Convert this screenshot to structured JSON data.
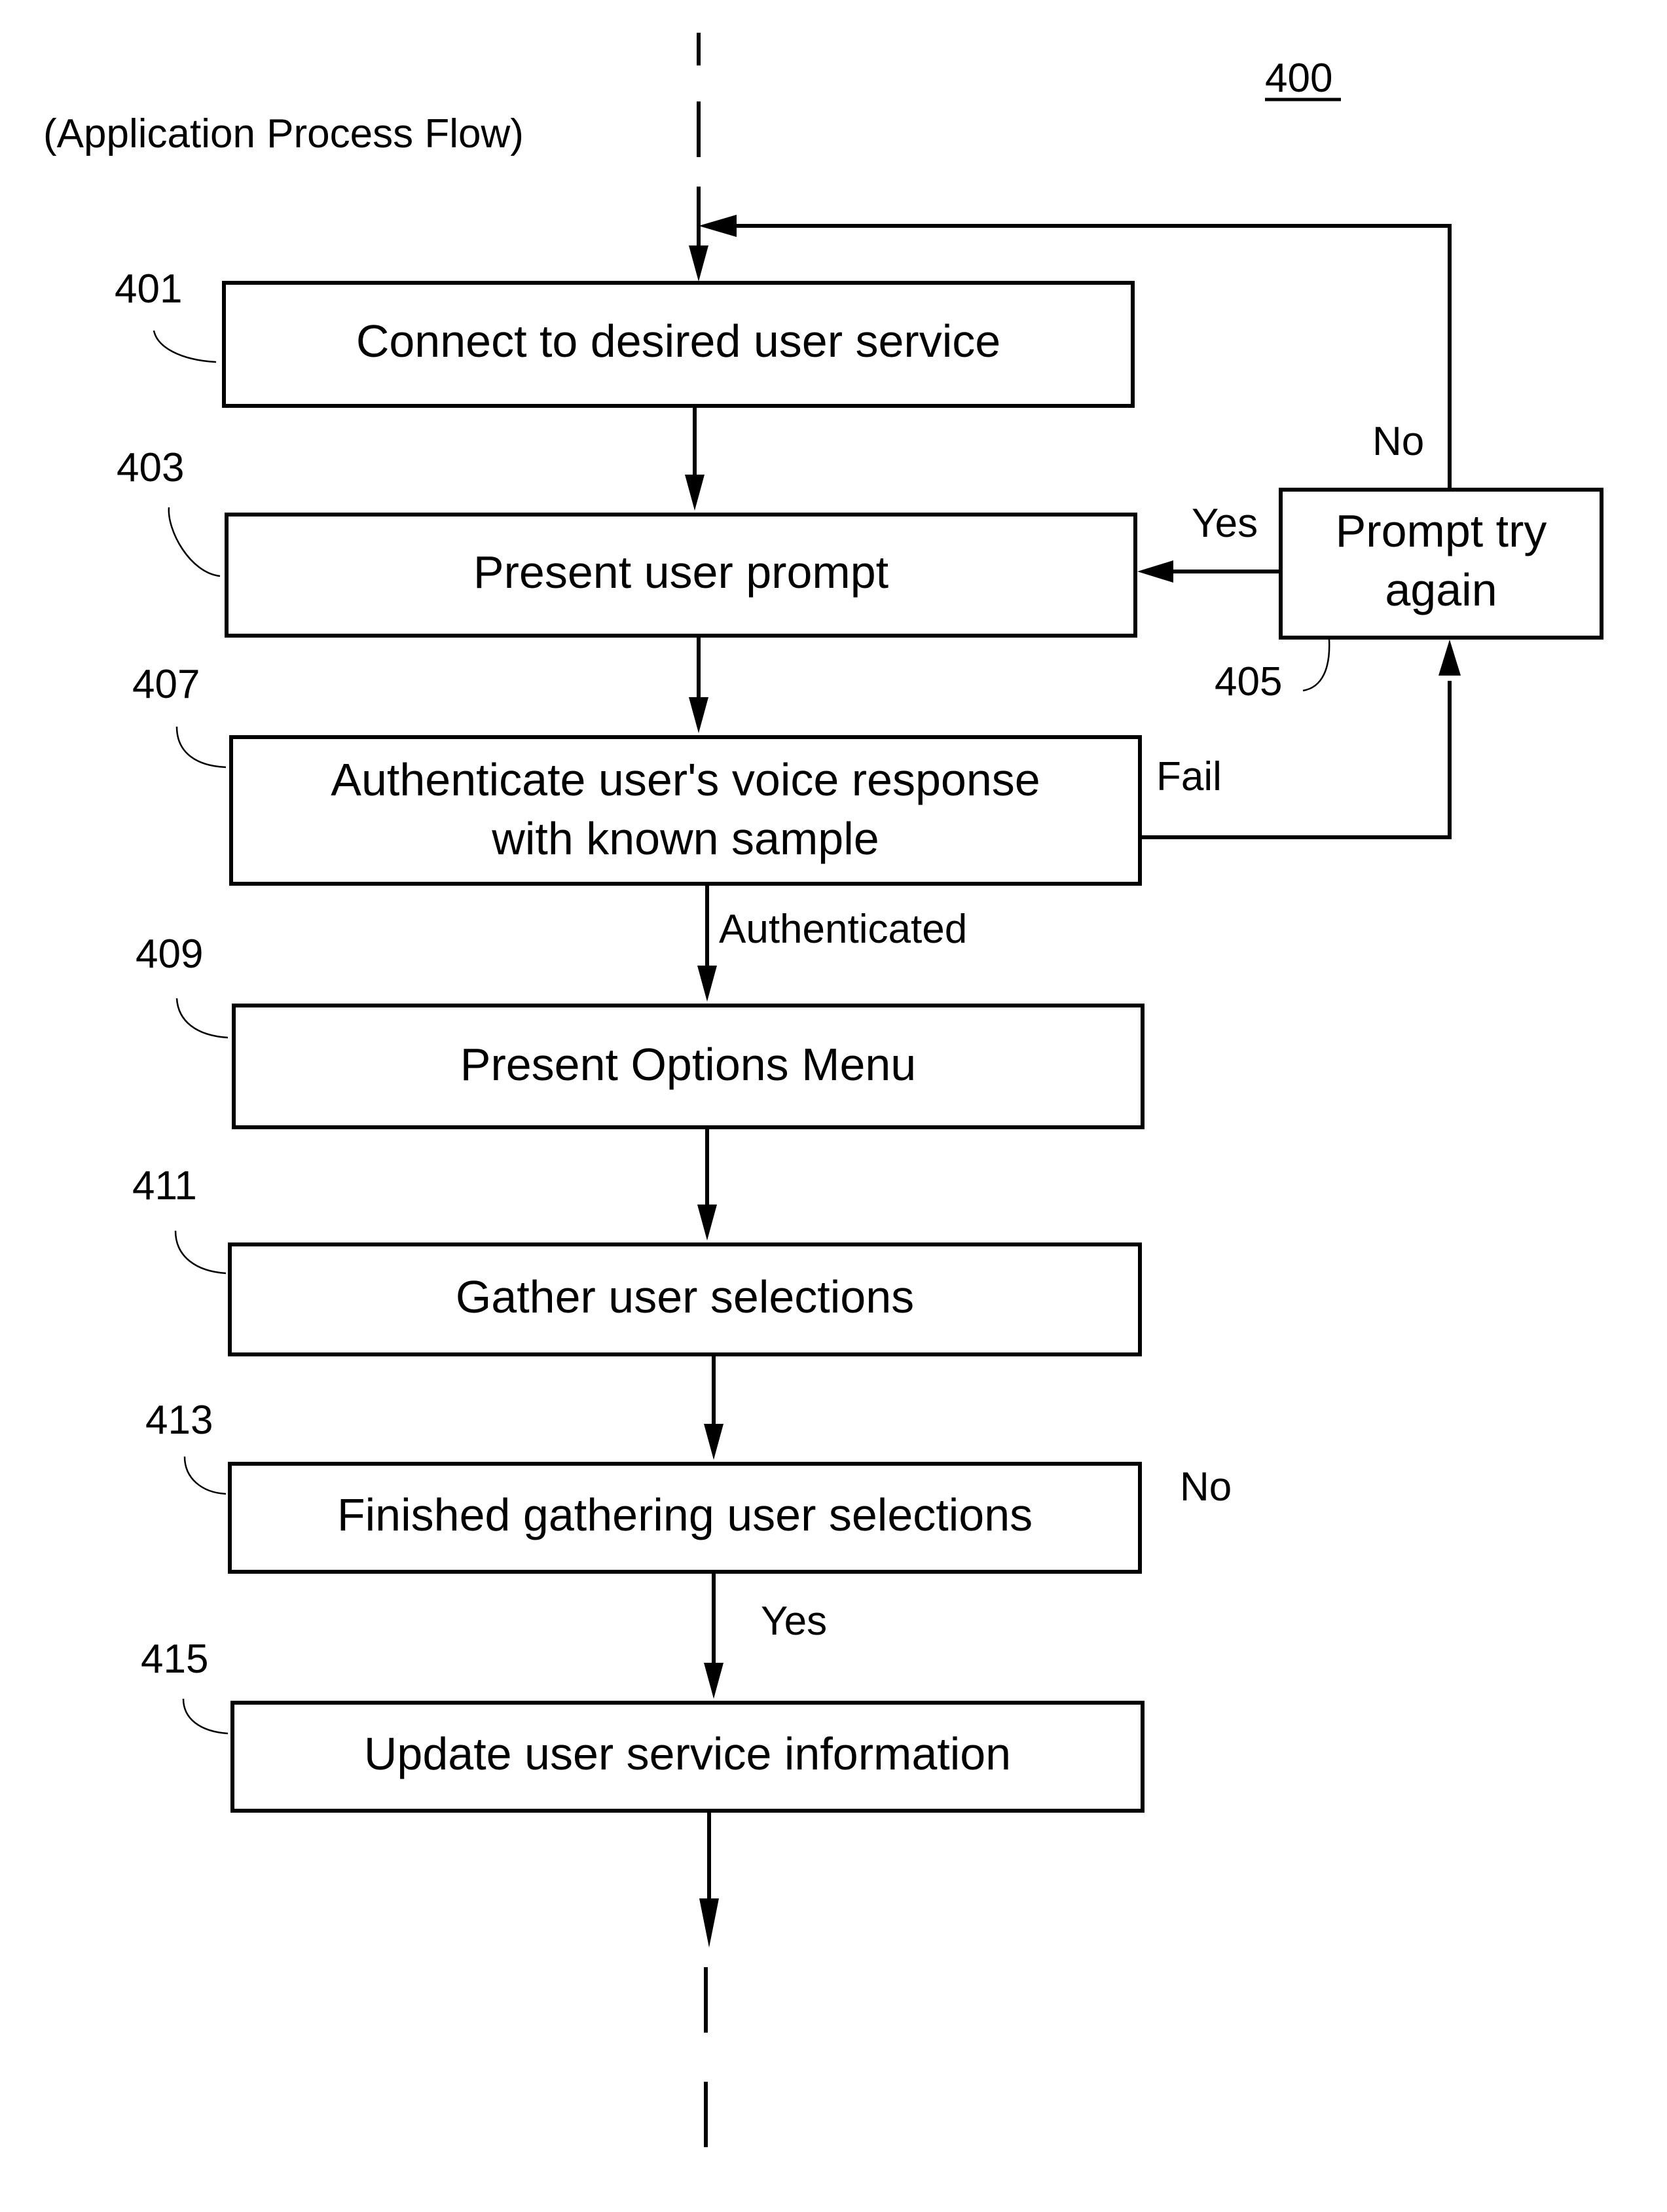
{
  "figure": {
    "number": "400",
    "caption": "(Application Process Flow)"
  },
  "steps": [
    {
      "ref": "401",
      "lines": [
        "Connect to desired user service"
      ]
    },
    {
      "ref": "403",
      "lines": [
        "Present user prompt"
      ]
    },
    {
      "ref": "405",
      "lines": [
        "Prompt try",
        "again"
      ]
    },
    {
      "ref": "407",
      "lines": [
        "Authenticate user's voice response",
        "with known sample"
      ]
    },
    {
      "ref": "409",
      "lines": [
        "Present Options Menu"
      ]
    },
    {
      "ref": "411",
      "lines": [
        "Gather user selections"
      ]
    },
    {
      "ref": "413",
      "lines": [
        "Finished gathering user selections"
      ]
    },
    {
      "ref": "415",
      "lines": [
        "Update user service information"
      ]
    }
  ],
  "edge_labels": {
    "retry_no": "No",
    "retry_yes": "Yes",
    "auth_fail": "Fail",
    "auth_ok": "Authenticated",
    "finished_no": "No",
    "finished_yes": "Yes"
  }
}
